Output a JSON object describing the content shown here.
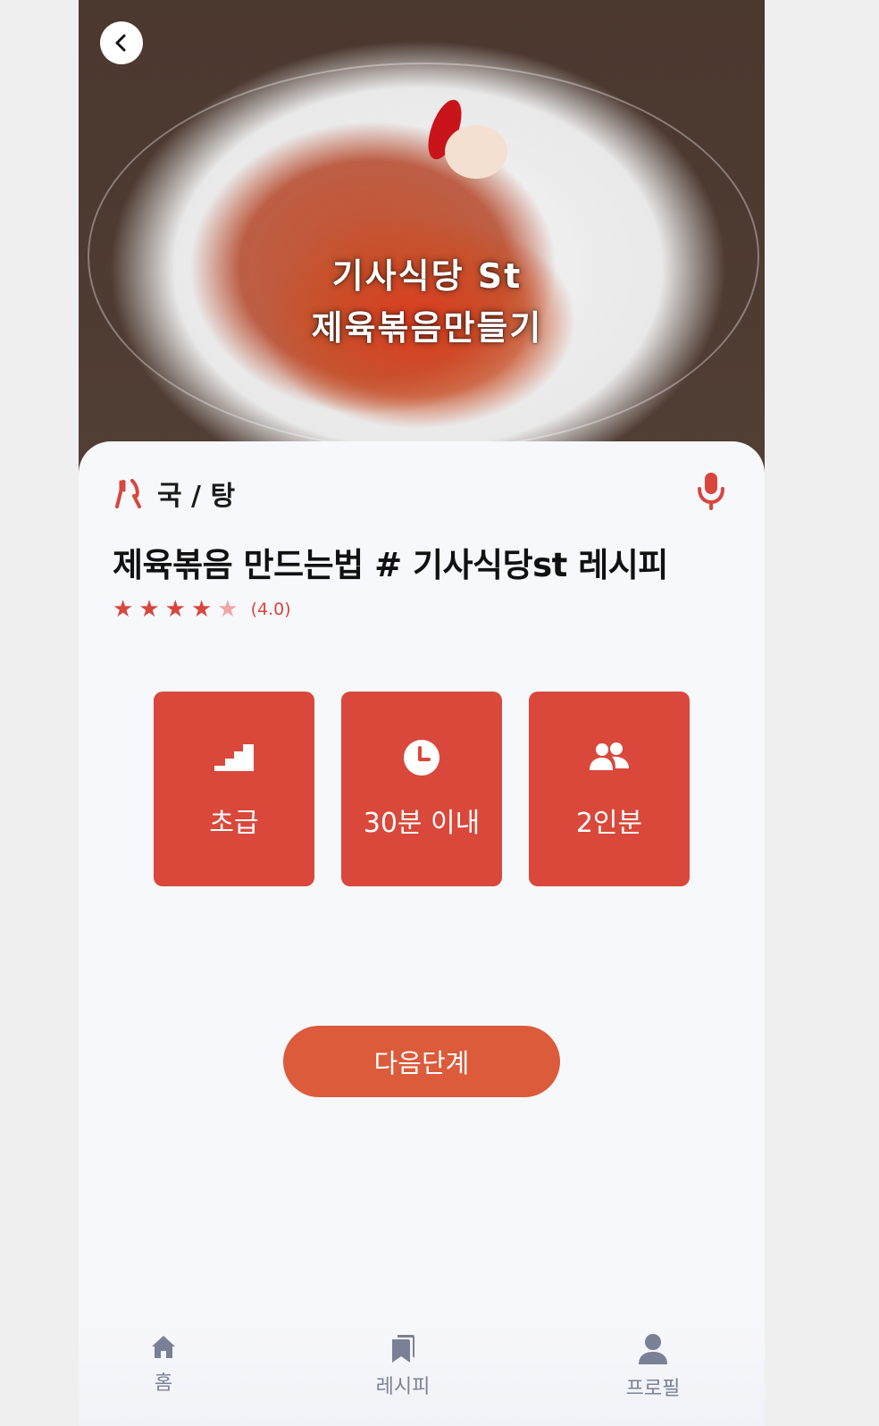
{
  "hero": {
    "caption_line1": "기사식당 St",
    "caption_line2": "제육볶음만들기"
  },
  "recipe": {
    "category": "국 / 탕",
    "title": "제육볶음 만드는법 # 기사식당st 레시피",
    "rating": {
      "stars_filled": 4,
      "stars_total": 5,
      "label": "(4.0)"
    }
  },
  "info_cards": [
    {
      "icon": "stairs-icon",
      "label": "초급"
    },
    {
      "icon": "clock-icon",
      "label": "30분 이내"
    },
    {
      "icon": "people-icon",
      "label": "2인분"
    }
  ],
  "actions": {
    "next_label": "다음단계"
  },
  "bottom_nav": {
    "items": [
      {
        "icon": "home-icon",
        "label": "홈"
      },
      {
        "icon": "bookmark-icon",
        "label": "레시피"
      },
      {
        "icon": "user-icon",
        "label": "프로필"
      }
    ]
  },
  "colors": {
    "accent": "#d9483b",
    "button": "#db5b3b",
    "nav_gray": "#7a8196",
    "background": "#f7f8fc"
  }
}
